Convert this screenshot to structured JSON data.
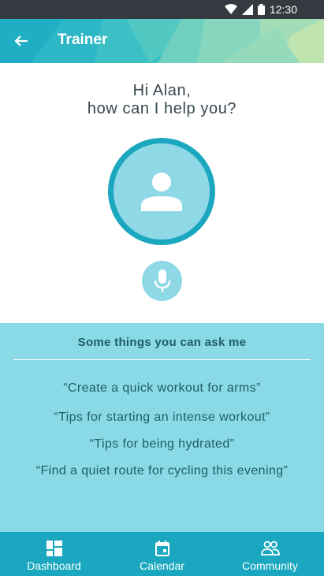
{
  "status_bar": {
    "time": "12:30"
  },
  "app_bar": {
    "title": "Trainer"
  },
  "greeting": {
    "line1": "Hi Alan,",
    "line2": "how can I help you?"
  },
  "suggestions": {
    "title": "Some things you can ask me",
    "items": [
      "“Create a quick workout for arms”",
      "“Tips for starting an intense workout”",
      "“Tips for being hydrated”",
      "“Find a quiet route for cycling this evening”"
    ]
  },
  "bottom_nav": {
    "items": [
      {
        "label": "Dashboard",
        "icon": "dashboard-icon"
      },
      {
        "label": "Calendar",
        "icon": "calendar-icon"
      },
      {
        "label": "Community",
        "icon": "community-icon"
      }
    ]
  },
  "colors": {
    "accent": "#1aa7bf",
    "light_accent": "#8ad9e6",
    "text_dark": "#37474f",
    "status_bar": "#343a40"
  }
}
